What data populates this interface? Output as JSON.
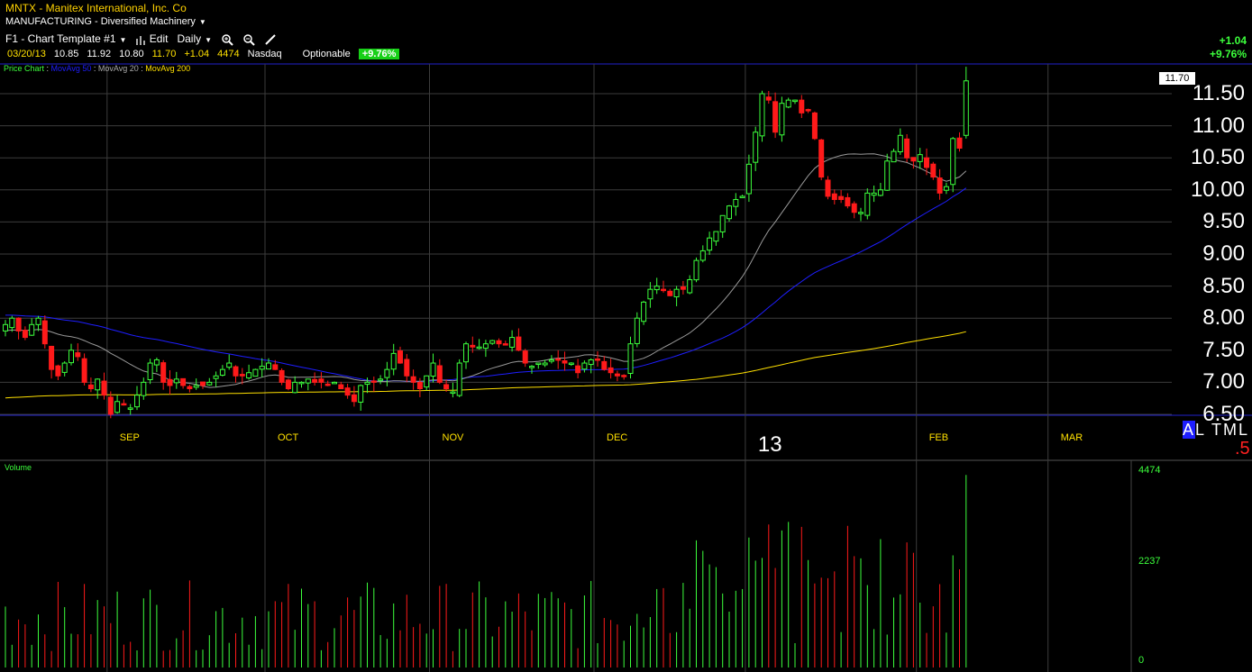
{
  "header": {
    "title": "MNTX - Manitex International, Inc. Co",
    "industry": "MANUFACTURING - Diversified Machinery"
  },
  "toolbar": {
    "template": "F1 - Chart Template #1",
    "edit_label": "Edit",
    "period": "Daily"
  },
  "quote": {
    "date": "03/20/13",
    "open": "10.85",
    "high": "11.92",
    "low": "10.80",
    "close": "11.70",
    "change": "+1.04",
    "volume": "4474",
    "exchange": "Nasdaq",
    "optionable": "Optionable",
    "pct_change": "+9.76%"
  },
  "top_right": {
    "change": "+1.04",
    "pct": "+9.76%"
  },
  "legend": {
    "price_chart": "Price Chart",
    "ma50": "MovAvg 50",
    "ma20": "MovAvg 20",
    "ma200": "MovAvg 200"
  },
  "price_box": "11.70",
  "scale_buttons": {
    "a": "A",
    "l": "L",
    "t": "T",
    "m": "M",
    "l2": "L"
  },
  "scale_suffix": ".5",
  "volume_panel": {
    "label": "Volume",
    "ticks": [
      "4474",
      "2237",
      "0"
    ]
  },
  "colors": {
    "up": "#3cff3c",
    "down": "#ff1a1a",
    "ma50": "#1e1eff",
    "ma20": "#9a9a9a",
    "ma200": "#ffe000",
    "grid": "#3c3c3c"
  },
  "chart_data": {
    "type": "candlestick",
    "title": "MNTX - Manitex International, Inc. Co",
    "period": "Daily",
    "ylim": [
      6.5,
      11.8
    ],
    "yticks": [
      "11.50",
      "11.00",
      "10.50",
      "10.00",
      "9.50",
      "9.00",
      "8.50",
      "8.00",
      "7.50",
      "7.00",
      "6.50"
    ],
    "ytick_values": [
      11.5,
      11.0,
      10.5,
      10.0,
      9.5,
      9.0,
      8.5,
      8.0,
      7.5,
      7.0,
      6.5
    ],
    "x_labels": [
      {
        "label": "SEP",
        "index": 16
      },
      {
        "label": "OCT",
        "index": 40
      },
      {
        "label": "NOV",
        "index": 65
      },
      {
        "label": "DEC",
        "index": 90
      },
      {
        "label": "13",
        "index": 113
      },
      {
        "label": "FEB",
        "index": 139
      },
      {
        "label": "MAR",
        "index": 159
      }
    ],
    "closes": [
      7.9,
      8.0,
      7.8,
      7.7,
      7.9,
      8.0,
      7.6,
      7.2,
      7.1,
      7.3,
      7.5,
      7.4,
      7.0,
      6.9,
      7.05,
      6.8,
      6.5,
      6.7,
      6.65,
      6.6,
      6.8,
      7.0,
      7.3,
      7.35,
      7.0,
      6.95,
      7.05,
      6.95,
      6.9,
      6.95,
      6.95,
      7.0,
      7.1,
      7.2,
      7.3,
      7.1,
      7.1,
      7.15,
      7.2,
      7.25,
      7.3,
      7.2,
      7.0,
      6.9,
      7.0,
      7.0,
      7.05,
      7.0,
      7.0,
      6.95,
      7.0,
      6.9,
      6.8,
      6.7,
      6.95,
      7.0,
      7.0,
      7.05,
      7.2,
      7.45,
      7.3,
      7.1,
      7.0,
      6.9,
      7.1,
      7.3,
      7.0,
      6.9,
      6.85,
      7.3,
      7.6,
      7.55,
      7.55,
      7.6,
      7.65,
      7.6,
      7.6,
      7.7,
      7.5,
      7.3,
      7.25,
      7.3,
      7.3,
      7.35,
      7.35,
      7.3,
      7.3,
      7.15,
      7.3,
      7.35,
      7.35,
      7.2,
      7.15,
      7.1,
      7.1,
      7.6,
      8.0,
      8.25,
      8.45,
      8.5,
      8.45,
      8.35,
      8.45,
      8.45,
      8.6,
      8.9,
      9.05,
      9.25,
      9.35,
      9.6,
      9.75,
      9.85,
      9.9,
      10.4,
      10.9,
      11.5,
      11.4,
      10.9,
      11.35,
      11.4,
      11.4,
      11.2,
      11.25,
      10.8,
      10.2,
      9.9,
      9.85,
      9.85,
      9.75,
      9.65,
      9.65,
      9.95,
      9.95,
      10.0,
      10.45,
      10.6,
      10.85,
      10.5,
      10.45,
      10.55,
      10.35,
      10.2,
      9.95,
      10.05,
      10.8,
      10.65,
      11.7
    ],
    "volume": [
      4474
    ],
    "last": {
      "open": 10.85,
      "high": 11.92,
      "low": 10.8,
      "close": 11.7,
      "volume": 4474
    }
  }
}
